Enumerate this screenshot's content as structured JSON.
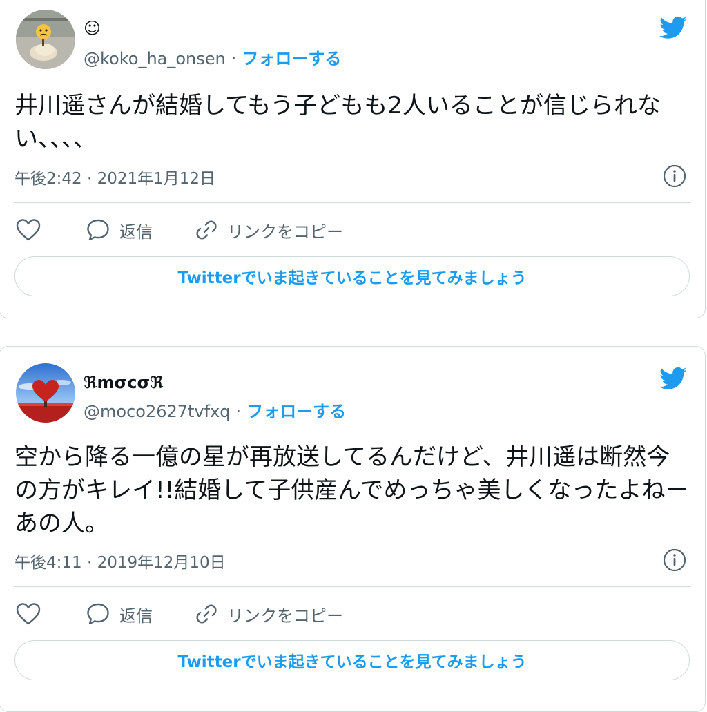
{
  "colors": {
    "accent": "#1d9bf0",
    "muted": "#536471",
    "border": "#cfd9de",
    "text": "#0f1419"
  },
  "tweets": [
    {
      "display_name": "☺",
      "handle": "@koko_ha_onsen",
      "separator": "·",
      "follow_label": "フォローする",
      "text": "井川遥さんが結婚してもう子どもも2人いることが信じられない、、、、",
      "timestamp": "午後2:42 · 2021年1月12日",
      "reply_label": "返信",
      "copy_link_label": "リンクをコピー",
      "cta_label": "Twitterでいま起きていることを見てみましょう",
      "icons": {
        "like": "heart-icon",
        "reply": "speech-bubble-icon",
        "link": "link-icon",
        "info": "info-icon",
        "brand": "twitter-bird-icon"
      }
    },
    {
      "display_name": "ℜmσcσℜ",
      "handle": "@moco2627tvfxq",
      "separator": "·",
      "follow_label": "フォローする",
      "text": "空から降る一億の星が再放送してるんだけど、井川遥は断然今の方がキレイ!!結婚して子供産んでめっちゃ美しくなったよねーあの人。",
      "timestamp": "午後4:11 · 2019年12月10日",
      "reply_label": "返信",
      "copy_link_label": "リンクをコピー",
      "cta_label": "Twitterでいま起きていることを見てみましょう",
      "icons": {
        "like": "heart-icon",
        "reply": "speech-bubble-icon",
        "link": "link-icon",
        "info": "info-icon",
        "brand": "twitter-bird-icon"
      }
    }
  ]
}
